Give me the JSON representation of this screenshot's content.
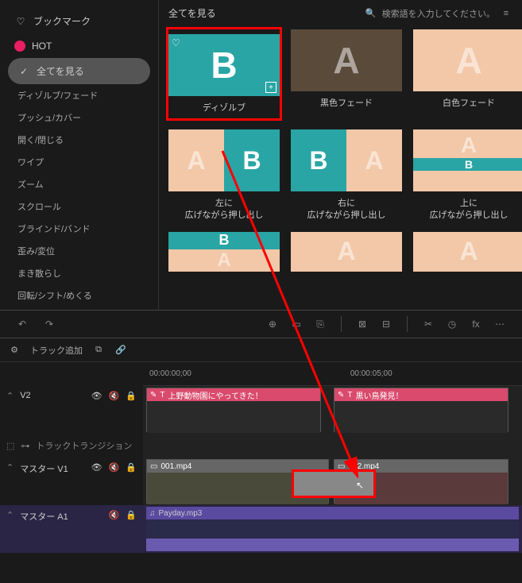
{
  "sidebar": {
    "bookmark": "ブックマーク",
    "hot": "HOT",
    "view_all": "全てを見る",
    "categories": [
      "ディゾルブ/フェード",
      "プッシュ/カバー",
      "開く/閉じる",
      "ワイプ",
      "ズーム",
      "スクロール",
      "ブラインド/バンド",
      "歪み/変位",
      "まき散らし",
      "回転/シフト/めくる"
    ]
  },
  "browser": {
    "header": "全てを見る",
    "search_placeholder": "検索語を入力してください。",
    "items": [
      {
        "label": "ディゾルブ"
      },
      {
        "label": "黒色フェード"
      },
      {
        "label": "白色フェード"
      },
      {
        "label": "左に\n広げながら押し出し"
      },
      {
        "label": "右に\n広げながら押し出し"
      },
      {
        "label": "上に\n広げながら押し出し"
      }
    ]
  },
  "timeline": {
    "add_track": "トラック追加",
    "ruler": [
      "00:00:00;00",
      "00:00:05;00"
    ],
    "tracks": {
      "v2": "V2",
      "transition": "トラックトランジション",
      "v1": "マスター V1",
      "a1": "マスター A1"
    },
    "clips": {
      "text1": "上野動物園にやってきた！",
      "text2": "黒い鳥発見！",
      "vid1": "001.mp4",
      "vid2": "002.mp4",
      "audio": "Payday.mp3"
    }
  }
}
